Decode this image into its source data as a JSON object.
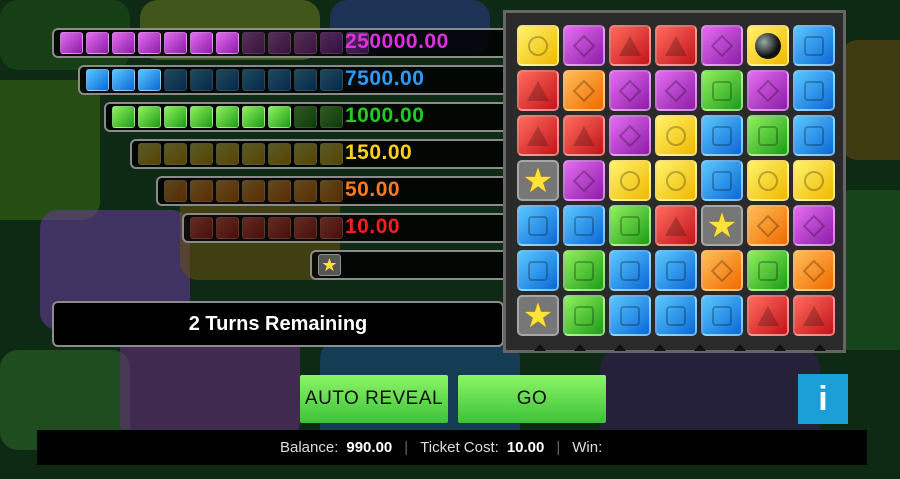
{
  "paytable": [
    {
      "value": "250000.00",
      "color": "#e02ee0",
      "gem": "purple",
      "total": 12,
      "filled": 7
    },
    {
      "value": "7500.00",
      "color": "#2a9bff",
      "gem": "blue",
      "total": 10,
      "filled": 3
    },
    {
      "value": "1000.00",
      "color": "#22cc22",
      "gem": "green",
      "total": 9,
      "filled": 7
    },
    {
      "value": "150.00",
      "color": "#ffd21a",
      "gem": "yellow",
      "total": 8,
      "filled": 0
    },
    {
      "value": "50.00",
      "color": "#ff7a1a",
      "gem": "orange",
      "total": 7,
      "filled": 0
    },
    {
      "value": "10.00",
      "color": "#ff1c1c",
      "gem": "red",
      "total": 6,
      "filled": 0
    },
    {
      "value": "",
      "color": "#ffe23a",
      "gem": "star",
      "total": 1,
      "filled": 1
    }
  ],
  "status": {
    "turns_text": "2 Turns Remaining"
  },
  "grid": [
    [
      "yellow",
      "purple",
      "red",
      "red",
      "purple",
      "bomb",
      "blue"
    ],
    [
      "red",
      "orange",
      "purple",
      "purple",
      "green",
      "purple",
      "blue"
    ],
    [
      "red",
      "red",
      "purple",
      "yellow",
      "blue",
      "green",
      "blue"
    ],
    [
      "star",
      "purple",
      "yellow",
      "yellow",
      "blue",
      "yellow",
      "yellow"
    ],
    [
      "blue",
      "blue",
      "green",
      "red",
      "star",
      "orange",
      "purple"
    ],
    [
      "blue",
      "green",
      "blue",
      "blue",
      "orange",
      "green",
      "orange"
    ],
    [
      "star",
      "green",
      "blue",
      "blue",
      "blue",
      "red",
      "red"
    ]
  ],
  "buttons": {
    "auto_reveal": "AUTO REVEAL",
    "go": "GO",
    "info": "i"
  },
  "footer": {
    "balance_label": "Balance:",
    "balance_value": "990.00",
    "cost_label": "Ticket Cost:",
    "cost_value": "10.00",
    "win_label": "Win:",
    "win_value": "",
    "separator": "|"
  }
}
